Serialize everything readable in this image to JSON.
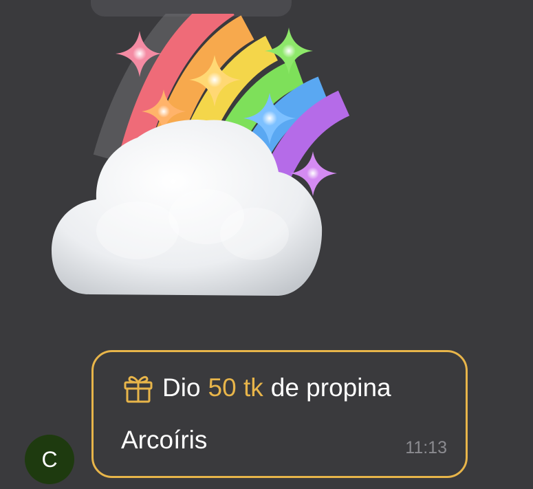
{
  "tip_message": {
    "prefix": "Dio",
    "amount": "50 tk",
    "suffix": "de propina",
    "sticker_name": "Arcoíris",
    "time": "11:13",
    "icon": "gift-icon"
  },
  "sender": {
    "avatar_initial": "C"
  },
  "sticker": {
    "icon": "rainbow-cloud-sticker"
  },
  "colors": {
    "background": "#3a3a3d",
    "accent": "#e8b54a",
    "avatar_bg": "#1e3a0f",
    "timestamp": "#8b8b90"
  }
}
